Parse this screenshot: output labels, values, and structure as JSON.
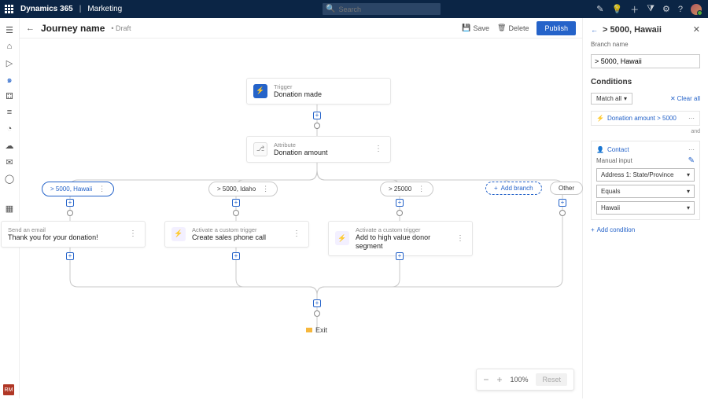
{
  "app": {
    "name": "Dynamics 365",
    "area": "Marketing"
  },
  "search": {
    "placeholder": "Search"
  },
  "header": {
    "title": "Journey name",
    "status": "• Draft",
    "save": "Save",
    "delete": "Delete",
    "publish": "Publish"
  },
  "nodes": {
    "trigger": {
      "label": "Trigger",
      "title": "Donation made"
    },
    "attribute": {
      "label": "Attribute",
      "title": "Donation amount"
    },
    "email": {
      "label": "Send an email",
      "title": "Thank you for your donation!"
    },
    "custom1": {
      "label": "Activate a custom trigger",
      "title": "Create sales phone call"
    },
    "custom2": {
      "label": "Activate a custom trigger",
      "title": "Add to high value donor segment"
    },
    "exit": "Exit"
  },
  "branches": {
    "b1": "> 5000, Hawaii",
    "b2": "> 5000, Idaho",
    "b3": "> 25000",
    "add": "Add branch",
    "other": "Other"
  },
  "zoom": {
    "value": "100%",
    "reset": "Reset"
  },
  "panel": {
    "title": "> 5000, Hawaii",
    "branch_name_label": "Branch name",
    "branch_name_value": "> 5000, Hawaii",
    "conditions": "Conditions",
    "match_all": "Match all",
    "clear_all": "Clear all",
    "cond1": "Donation amount > 5000",
    "and": "and",
    "contact": "Contact",
    "manual_input": "Manual input",
    "field1": "Address 1: State/Province",
    "operator": "Equals",
    "value": "Hawaii",
    "add_condition": "Add condition"
  },
  "rm": "RM"
}
